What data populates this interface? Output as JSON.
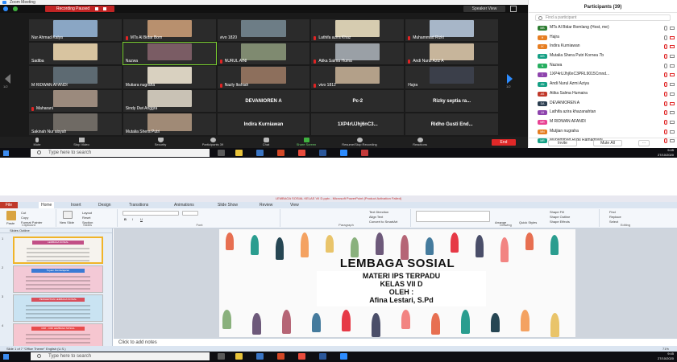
{
  "zoom": {
    "window_title": "Zoom Meeting",
    "recording_label": "Recording Paused",
    "speaker_view_label": "Speaker View",
    "page_left": "1/2",
    "page_right": "1/2",
    "tiles": [
      {
        "name": "Nur Ahmad Kalya",
        "mic_off": false,
        "text": false,
        "color": "#8aa6c4"
      },
      {
        "name": "MTs Al Bidar Bom",
        "mic_off": true,
        "text": false,
        "color": "#b8906e"
      },
      {
        "name": "vivo 1820",
        "mic_off": false,
        "text": false,
        "color": "#6d7d86"
      },
      {
        "name": "Lathifa azira Khaz",
        "mic_off": true,
        "text": false,
        "color": "#d6ccb0"
      },
      {
        "name": "Muhammad Rizki",
        "mic_off": true,
        "text": false,
        "color": "#a7b6c8"
      },
      {
        "name": "Sadiba",
        "mic_off": false,
        "text": false,
        "color": "#d8c4a0"
      },
      {
        "name": "Nazwa",
        "mic_off": false,
        "text": false,
        "color": "#7a5c64",
        "active": true
      },
      {
        "name": "NURUL AINI",
        "mic_off": true,
        "text": false,
        "color": "#7f8a70"
      },
      {
        "name": "Atika Salma Huma",
        "mic_off": true,
        "text": false,
        "color": "#9aa0a6"
      },
      {
        "name": "Andi Nurul Aziz A",
        "mic_off": true,
        "text": false,
        "color": "#c7b59b"
      },
      {
        "name": "M RIDWAN AFANDI",
        "mic_off": false,
        "text": false,
        "color": "#5d6a72"
      },
      {
        "name": "Mutiara nugraha",
        "mic_off": false,
        "text": false,
        "color": "#d9d1c0"
      },
      {
        "name": "Nazly Ikshiah",
        "mic_off": true,
        "text": false,
        "color": "#8d6f5c"
      },
      {
        "name": "vivo 1812",
        "mic_off": true,
        "text": false,
        "color": "#b3a089"
      },
      {
        "name": "Hajra",
        "mic_off": false,
        "text": false,
        "color": "#3b3f4a"
      },
      {
        "name": "Maharani",
        "mic_off": true,
        "text": false,
        "color": "#9b8a7d"
      },
      {
        "name": "Sindy Dwi Anggra",
        "mic_off": false,
        "text": false,
        "color": "#c9c2b5"
      },
      {
        "name": "DEVANIOREN A",
        "mic_off": false,
        "text": true
      },
      {
        "name": "Pc-2",
        "mic_off": false,
        "text": true
      },
      {
        "name": "Rizky septia ra...",
        "mic_off": false,
        "text": true
      },
      {
        "name": "Sakinah Nur aisyah",
        "mic_off": false,
        "text": false,
        "color": "#6f6a64"
      },
      {
        "name": "Mutalia Shera Putri",
        "mic_off": false,
        "text": false,
        "color": "#a08a76"
      },
      {
        "name": "Indira Kurniawan",
        "mic_off": false,
        "text": true
      },
      {
        "name": "1XP4rUJhj6nC3...",
        "mic_off": false,
        "text": true
      },
      {
        "name": "Ridho Gusti End...",
        "mic_off": false,
        "text": true
      }
    ],
    "toolbar": {
      "mute": "Mute",
      "stop_video": "Stop Video",
      "security": "Security",
      "participants": "Participants",
      "participants_count": "39",
      "chat": "Chat",
      "share_screen": "Share Screen",
      "resume_recording": "Resume/Stop Recording",
      "reactions": "Reactions",
      "end": "End"
    },
    "panel": {
      "title": "Participants (39)",
      "search_placeholder": "Find a participant",
      "participants": [
        {
          "initials": "MB",
          "name": "MTs Al Bidar Bomlang (Host, me)",
          "color": "#2e7d32",
          "mic_red": false,
          "cam_red": false
        },
        {
          "initials": "H",
          "name": "Hajra",
          "color": "#e67e22",
          "mic_red": false,
          "cam_red": true
        },
        {
          "initials": "IK",
          "name": "Indira Kurniawan",
          "color": "#e67e22",
          "mic_red": true,
          "cam_red": true
        },
        {
          "initials": "MS",
          "name": "Mutalia Shera Putri Kornea 7b",
          "color": "#16a085",
          "mic_red": true,
          "cam_red": false
        },
        {
          "initials": "N",
          "name": "Nazwa",
          "color": "#27ae60",
          "mic_red": false,
          "cam_red": false
        },
        {
          "initials": "1",
          "name": "1XP4rUJhj6nC3PRL9015Cmnd...",
          "color": "#8e44ad",
          "mic_red": true,
          "cam_red": true
        },
        {
          "initials": "AN",
          "name": "Andi Nurul Azmi Aziya",
          "color": "#16a085",
          "mic_red": true,
          "cam_red": false
        },
        {
          "initials": "AS",
          "name": "Atika Salma Humaira",
          "color": "#c0392b",
          "mic_red": true,
          "cam_red": false
        },
        {
          "initials": "DA",
          "name": "DEVANIOREN A",
          "color": "#2c3e50",
          "mic_red": true,
          "cam_red": true
        },
        {
          "initials": "LA",
          "name": "Lathifa azira khazanahtan",
          "color": "#8e44ad",
          "mic_red": true,
          "cam_red": false
        },
        {
          "initials": "MR",
          "name": "M RIDWAN AFANDI",
          "color": "#e84393",
          "mic_red": true,
          "cam_red": false
        },
        {
          "initials": "MN",
          "name": "Mutjian nugraha",
          "color": "#e67e22",
          "mic_red": true,
          "cam_red": false
        },
        {
          "initials": "MR",
          "name": "Muhammad Rizki Ramadhani",
          "color": "#16a085",
          "mic_red": true,
          "cam_red": false
        }
      ],
      "invite": "Invite",
      "mute_all": "Mute All"
    }
  },
  "taskbar_top": {
    "search_placeholder": "Type here to search",
    "clock_time": "9:45",
    "clock_date": "27/10/2020"
  },
  "ppt": {
    "title": "LEMBAGA SOSIAL KELAS VII D.pptx - Microsoft PowerPoint (Product Activation Failed)",
    "tabs": [
      "File",
      "Home",
      "Insert",
      "Design",
      "Transitions",
      "Animations",
      "Slide Show",
      "Review",
      "View"
    ],
    "ribbon": {
      "paste": "Paste",
      "cut": "Cut",
      "copy": "Copy",
      "format_painter": "Format Painter",
      "clipboard": "Clipboard",
      "new_slide": "New Slide",
      "layout": "Layout",
      "reset": "Reset",
      "section": "Section",
      "slides": "Slides",
      "font": "Font",
      "paragraph": "Paragraph",
      "text_direction": "Text Direction",
      "align_text": "Align Text",
      "convert_smartart": "Convert to SmartArt",
      "drawing": "Drawing",
      "arrange": "Arrange",
      "quick_styles": "Quick Styles",
      "shape_fill": "Shape Fill",
      "shape_outline": "Shape Outline",
      "shape_effects": "Shape Effects",
      "find": "Find",
      "replace": "Replace",
      "select": "Select",
      "editing": "Editing"
    },
    "pane_tabs": "Slides    Outline",
    "thumbs": [
      {
        "num": "1",
        "title": "LEMBAGA SOSIAL",
        "bg": "#f6f3ee",
        "band": "#c24f86"
      },
      {
        "num": "2",
        "title": "Tujuan Pembelajaran",
        "bg": "#f3c9d6",
        "band": "#3a7bd5"
      },
      {
        "num": "3",
        "title": "PENGERTIAN LEMBAGA SOSIAL",
        "bg": "#c9e3f2",
        "band": "#d94f5c"
      },
      {
        "num": "4",
        "title": "CIRI - CIRI LEMBAGA SOSIAL",
        "bg": "#f6c6d0",
        "band": "#e84d4d"
      }
    ],
    "slide": {
      "title": "LEMBAGA SOSIAL",
      "line1": "MATERI IPS TERPADU",
      "line2": "KELAS VII D",
      "line3": "OLEH :",
      "line4": "Afina Lestari, S.Pd"
    },
    "notes_placeholder": "Click to add notes",
    "status": "Slide 1 of 7    \"Office Theme\"    English (U.S.)",
    "zoom_level": "71%"
  },
  "taskbar_bottom": {
    "search_placeholder": "Type here to search",
    "clock_time": "9:45",
    "clock_date": "27/10/2020"
  }
}
